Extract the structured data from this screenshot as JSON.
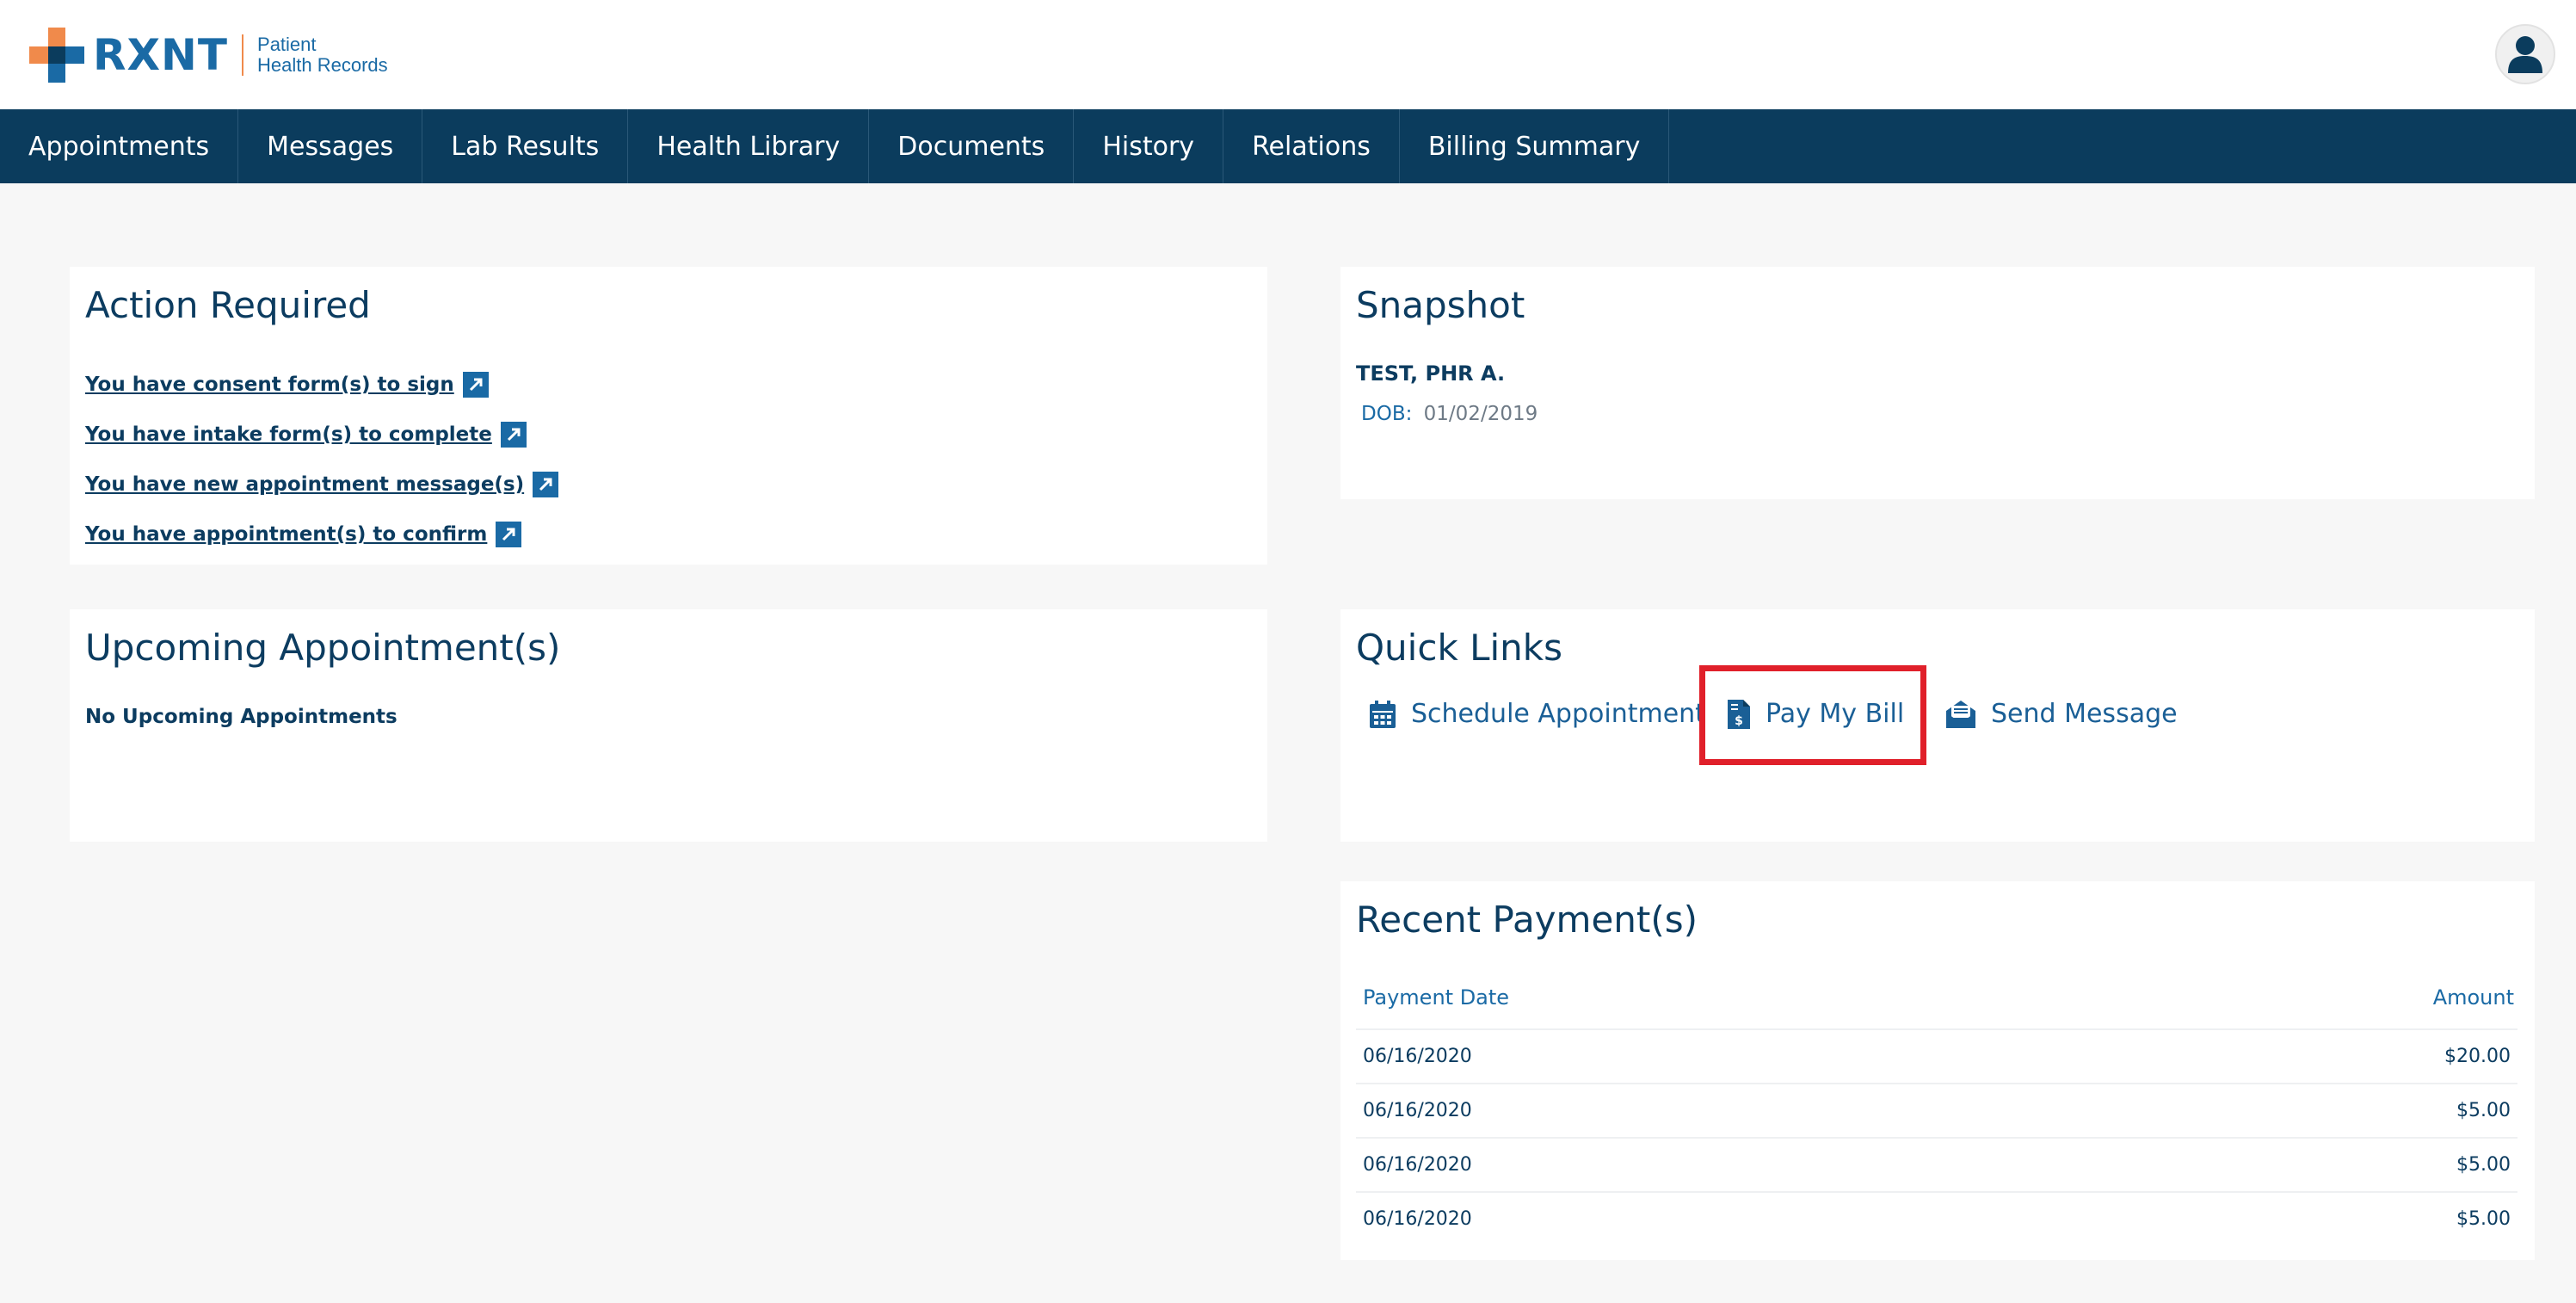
{
  "brand": {
    "name": "RXNT",
    "subtitle_line1": "Patient",
    "subtitle_line2": "Health Records",
    "colors": {
      "navy": "#0b3c5d",
      "blue": "#1a6aa5",
      "orange": "#f08a4b",
      "highlight": "#e0202a"
    }
  },
  "nav": {
    "items": [
      {
        "label": "Appointments"
      },
      {
        "label": "Messages"
      },
      {
        "label": "Lab Results"
      },
      {
        "label": "Health Library"
      },
      {
        "label": "Documents"
      },
      {
        "label": "History"
      },
      {
        "label": "Relations"
      },
      {
        "label": "Billing Summary"
      }
    ]
  },
  "action_required": {
    "title": "Action Required",
    "links": [
      {
        "label": "You have consent form(s) to sign"
      },
      {
        "label": "You have intake form(s) to complete"
      },
      {
        "label": "You have new appointment message(s)"
      },
      {
        "label": "You have appointment(s) to confirm"
      }
    ]
  },
  "snapshot": {
    "title": "Snapshot",
    "patient_name": "TEST, PHR A.",
    "dob_label": "DOB:",
    "dob_value": "01/02/2019"
  },
  "upcoming": {
    "title": "Upcoming Appointment(s)",
    "empty_text": "No Upcoming Appointments"
  },
  "quick_links": {
    "title": "Quick Links",
    "items": [
      {
        "label": "Schedule Appointment",
        "icon": "calendar-icon"
      },
      {
        "label": "Pay My Bill",
        "icon": "invoice-dollar-icon"
      },
      {
        "label": "Send Message",
        "icon": "envelope-open-icon"
      }
    ]
  },
  "recent_payments": {
    "title": "Recent Payment(s)",
    "columns": [
      "Payment Date",
      "Amount"
    ],
    "rows": [
      [
        "06/16/2020",
        "$20.00"
      ],
      [
        "06/16/2020",
        "$5.00"
      ],
      [
        "06/16/2020",
        "$5.00"
      ],
      [
        "06/16/2020",
        "$5.00"
      ]
    ]
  }
}
